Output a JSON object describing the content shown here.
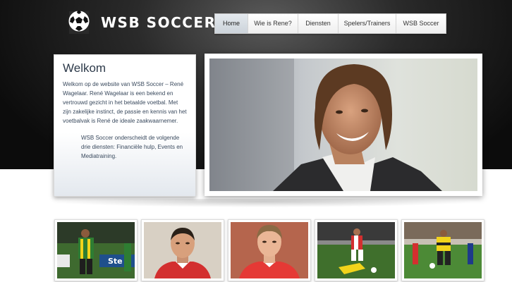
{
  "site": {
    "name": "WSB SOCCER",
    "logo_icon": "soccer-ball-icon"
  },
  "nav": {
    "items": [
      {
        "label": "Home",
        "active": true
      },
      {
        "label": "Wie is Rene?",
        "active": false
      },
      {
        "label": "Diensten",
        "active": false
      },
      {
        "label": "Spelers/Trainers",
        "active": false
      },
      {
        "label": "WSB Soccer",
        "active": false
      }
    ]
  },
  "welcome": {
    "title": "Welkom",
    "paragraph1": "Welkom op de website van WSB Soccer – René Wagelaar. René Wagelaar is een bekend en vertrouwd gezicht in het betaalde voetbal. Met zijn zakelijke instinct, de passie en kennis van het voetbalvak is René de ideale zaakwaarnemer.",
    "paragraph2": "WSB Soccer onderscheidt de volgende drie diensten: Financiële hulp, Events en Mediatraining."
  },
  "thumbnails": {
    "items": [
      {
        "alt": "green-yellow kit player"
      },
      {
        "alt": "player portrait red shirt"
      },
      {
        "alt": "young player portrait red shirt"
      },
      {
        "alt": "match action red white vs yellow"
      },
      {
        "alt": "match action yellow kit"
      }
    ]
  },
  "colors": {
    "header_dark": "#111111",
    "nav_active": "#d2d9e0",
    "welcome_title": "#2d3a4a",
    "body_text": "#3a4a5e"
  }
}
